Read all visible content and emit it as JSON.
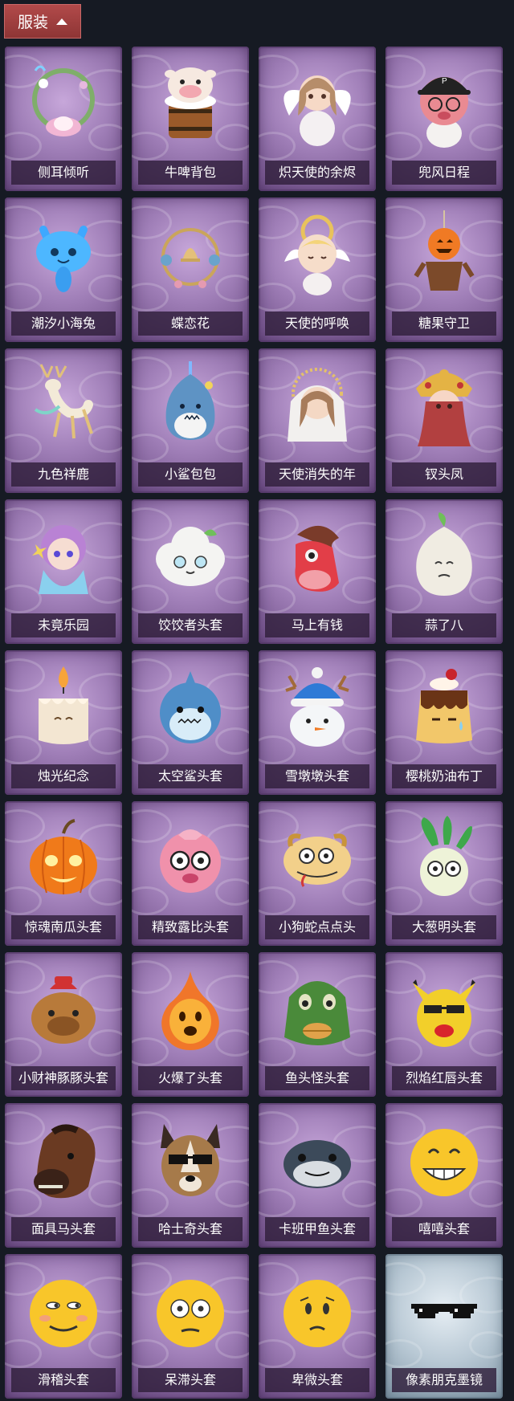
{
  "header": {
    "title": "服装",
    "toggle_icon": "chevron-up-icon"
  },
  "items": [
    {
      "name": "侧耳倾听",
      "icon": "flower-wreath-ornament-icon",
      "frame": "purple"
    },
    {
      "name": "牛啤背包",
      "icon": "cow-beer-mug-icon",
      "frame": "purple"
    },
    {
      "name": "炽天使的余烬",
      "icon": "angel-girl-icon",
      "frame": "purple"
    },
    {
      "name": "兜风日程",
      "icon": "pink-character-cap-icon",
      "frame": "purple"
    },
    {
      "name": "潮汐小海兔",
      "icon": "blue-sea-bunny-icon",
      "frame": "purple"
    },
    {
      "name": "蝶恋花",
      "icon": "bell-wreath-ornament-icon",
      "frame": "purple"
    },
    {
      "name": "天使的呼唤",
      "icon": "angel-cherub-icon",
      "frame": "purple"
    },
    {
      "name": "糖果守卫",
      "icon": "pumpkin-candy-guard-icon",
      "frame": "purple"
    },
    {
      "name": "九色祥鹿",
      "icon": "golden-deer-icon",
      "frame": "purple"
    },
    {
      "name": "小鲨包包",
      "icon": "shark-bag-icon",
      "frame": "purple"
    },
    {
      "name": "天使消失的年",
      "icon": "veiled-angel-icon",
      "frame": "purple"
    },
    {
      "name": "钗头凤",
      "icon": "phoenix-crown-girl-icon",
      "frame": "purple"
    },
    {
      "name": "未竟乐园",
      "icon": "pastel-girl-icon",
      "frame": "purple"
    },
    {
      "name": "饺饺者头套",
      "icon": "cloud-dumpling-head-icon",
      "frame": "purple"
    },
    {
      "name": "马上有钱",
      "icon": "red-horse-head-icon",
      "frame": "purple"
    },
    {
      "name": "蒜了八",
      "icon": "garlic-head-icon",
      "frame": "purple"
    },
    {
      "name": "烛光纪念",
      "icon": "candle-head-icon",
      "frame": "purple"
    },
    {
      "name": "太空鲨头套",
      "icon": "space-shark-head-icon",
      "frame": "purple"
    },
    {
      "name": "雪墩墩头套",
      "icon": "snowman-head-icon",
      "frame": "purple"
    },
    {
      "name": "樱桃奶油布丁",
      "icon": "cherry-pudding-head-icon",
      "frame": "purple"
    },
    {
      "name": "惊魂南瓜头套",
      "icon": "pumpkin-head-icon",
      "frame": "purple"
    },
    {
      "name": "精致露比头套",
      "icon": "pink-ruby-head-icon",
      "frame": "purple"
    },
    {
      "name": "小狗蛇点点头",
      "icon": "snake-dog-head-icon",
      "frame": "purple"
    },
    {
      "name": "大葱明头套",
      "icon": "green-onion-head-icon",
      "frame": "purple"
    },
    {
      "name": "小财神豚豚头套",
      "icon": "capybara-head-icon",
      "frame": "purple"
    },
    {
      "name": "火爆了头套",
      "icon": "fire-head-icon",
      "frame": "purple"
    },
    {
      "name": "鱼头怪头套",
      "icon": "fish-head-icon",
      "frame": "purple"
    },
    {
      "name": "烈焰红唇头套",
      "icon": "yellow-mouse-sunglasses-icon",
      "frame": "purple"
    },
    {
      "name": "面具马头套",
      "icon": "horse-mask-icon",
      "frame": "purple"
    },
    {
      "name": "哈士奇头套",
      "icon": "husky-sunglasses-icon",
      "frame": "purple"
    },
    {
      "name": "卡班甲鱼头套",
      "icon": "grey-fish-head-icon",
      "frame": "purple"
    },
    {
      "name": "嘻嘻头套",
      "icon": "grin-emoji-head-icon",
      "frame": "purple"
    },
    {
      "name": "滑稽头套",
      "icon": "smirk-emoji-head-icon",
      "frame": "purple"
    },
    {
      "name": "呆滞头套",
      "icon": "dazed-emoji-head-icon",
      "frame": "purple"
    },
    {
      "name": "卑微头套",
      "icon": "humble-emoji-head-icon",
      "frame": "purple"
    },
    {
      "name": "像素朋克墨镜",
      "icon": "pixel-sunglasses-icon",
      "frame": "silver"
    }
  ]
}
